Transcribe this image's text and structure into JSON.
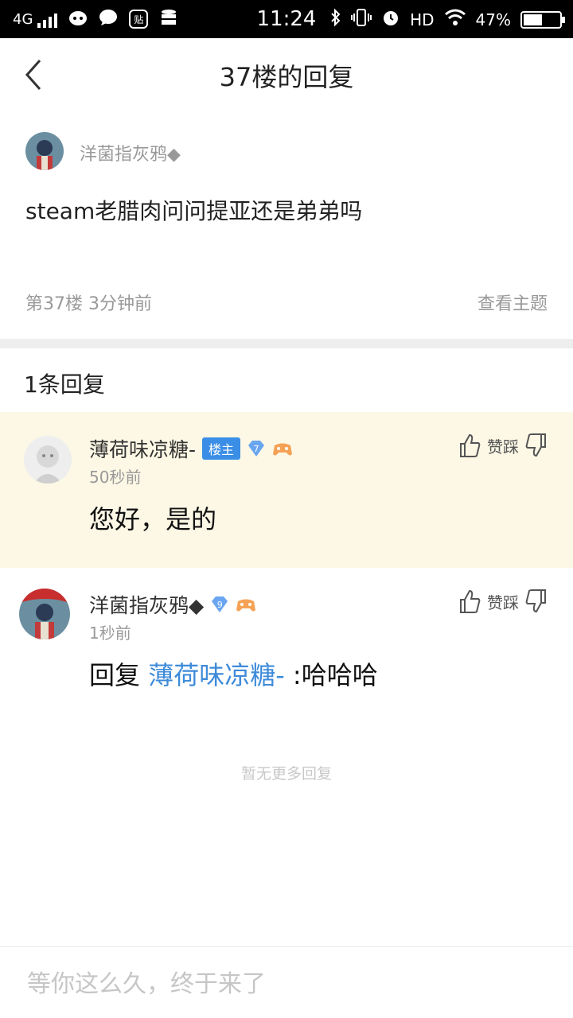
{
  "status_bar": {
    "network": "4G",
    "time": "11:24",
    "hd": "HD",
    "battery": "47%",
    "battery_level": 0.47,
    "notif_icons": [
      "cat-icon",
      "chat-icon",
      "tieba-icon",
      "stack-icon"
    ]
  },
  "header": {
    "title": "37楼的回复"
  },
  "post": {
    "author": "洋菌指灰鸦◆",
    "content": "steam老腊肉问问提亚还是弟弟吗",
    "floor_info": "第37楼  3分钟前",
    "view_topic": "查看主题"
  },
  "reply_count": "1条回复",
  "replies": [
    {
      "name": "薄荷味凉糖-",
      "badge": "楼主",
      "level": "7",
      "time": "50秒前",
      "text": "您好，是的",
      "like_label": "赞踩"
    },
    {
      "name": "洋菌指灰鸦◆",
      "level": "9",
      "time": "1秒前",
      "text_prefix": "回复 ",
      "text_link": "薄荷味凉糖-",
      "text_suffix": " :哈哈哈",
      "like_label": "赞踩"
    }
  ],
  "no_more": "暂无更多回复",
  "input": {
    "placeholder": "等你这么久，终于来了"
  },
  "colors": {
    "link": "#3e8bd9",
    "highlight_bg": "#fcf8e5",
    "badge": "#3a8ee6"
  }
}
